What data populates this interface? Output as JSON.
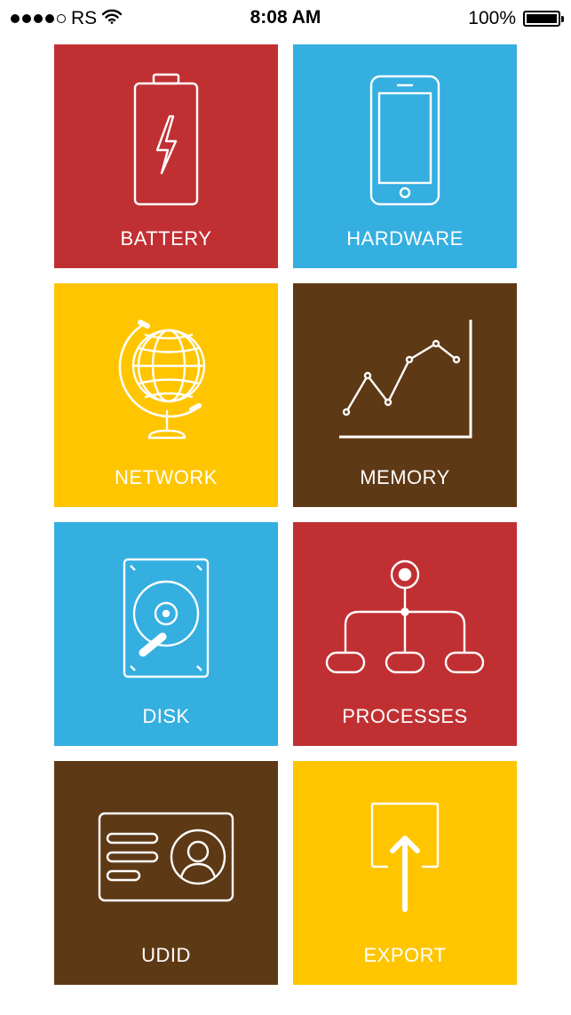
{
  "status_bar": {
    "carrier": "RS",
    "time": "8:08 AM",
    "battery_percent": "100%",
    "signal_bars_filled": 4,
    "signal_bars_total": 5,
    "icons": [
      "signal-dots-icon",
      "wifi-icon",
      "battery-icon"
    ]
  },
  "colors": {
    "red": "#C03033",
    "blue": "#34AFE0",
    "yellow": "#FFC500",
    "brown": "#5E3915"
  },
  "tiles": [
    {
      "label": "BATTERY",
      "icon": "battery-icon",
      "color": "#C03033"
    },
    {
      "label": "HARDWARE",
      "icon": "phone-icon",
      "color": "#34AFE0"
    },
    {
      "label": "NETWORK",
      "icon": "globe-icon",
      "color": "#FFC500"
    },
    {
      "label": "MEMORY",
      "icon": "line-chart-icon",
      "color": "#5E3915"
    },
    {
      "label": "DISK",
      "icon": "hard-disk-icon",
      "color": "#34AFE0"
    },
    {
      "label": "PROCESSES",
      "icon": "hierarchy-icon",
      "color": "#C03033"
    },
    {
      "label": "UDID",
      "icon": "id-card-icon",
      "color": "#5E3915"
    },
    {
      "label": "EXPORT",
      "icon": "export-icon",
      "color": "#FFC500"
    }
  ]
}
